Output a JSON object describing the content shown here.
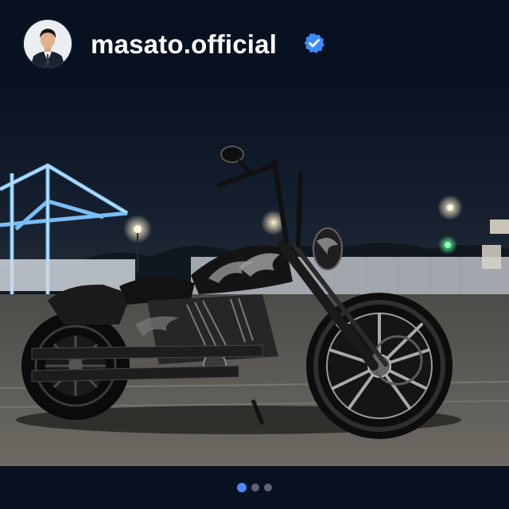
{
  "post": {
    "username": "masato.official",
    "verified": true,
    "accent_color": "#3d8bfd",
    "avatar_icon": "profile-avatar",
    "photo_subject": "motorcycle-at-night",
    "carousel": {
      "total": 3,
      "current": 1
    }
  }
}
